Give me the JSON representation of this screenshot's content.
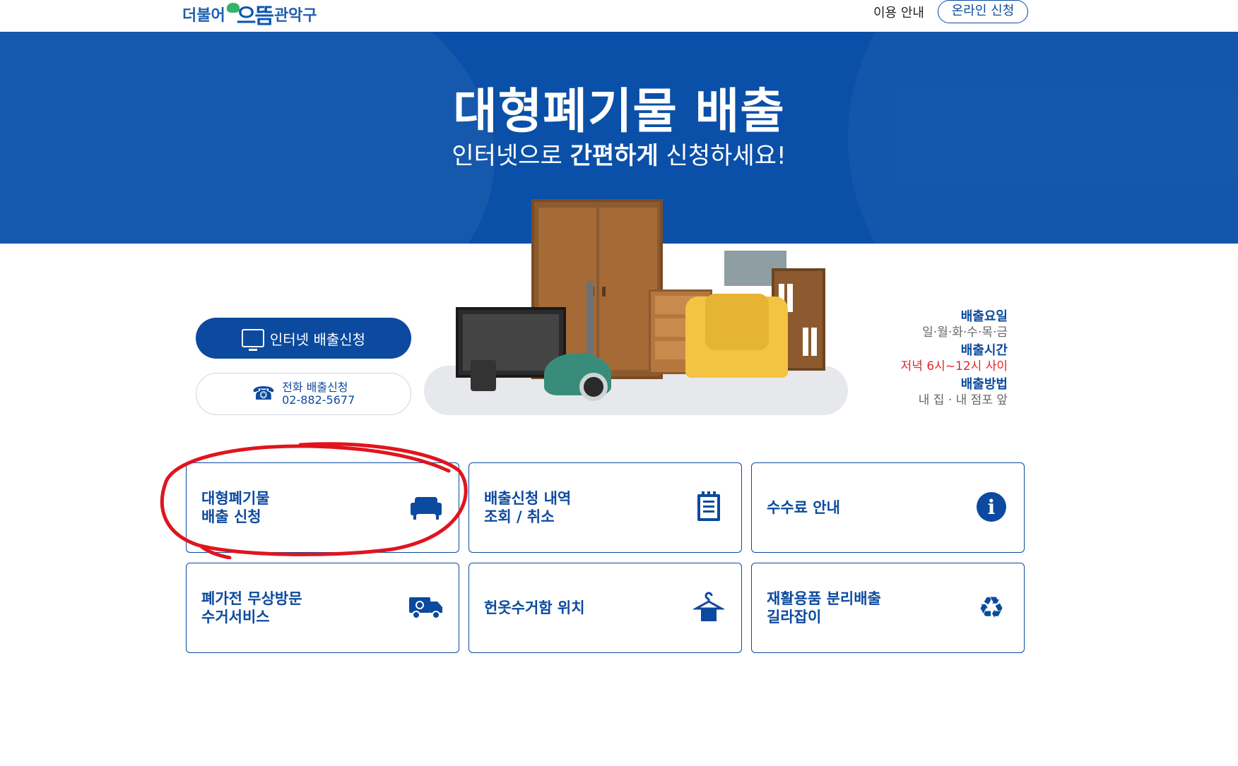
{
  "header": {
    "logo_left": "더불어",
    "logo_mid": "으뜸",
    "logo_right": "관악구",
    "nav_guide": "이용 안내",
    "nav_apply": "온라인 신청"
  },
  "hero": {
    "title": "대형폐기물 배출",
    "subtitle_pre": "인터넷으로 ",
    "subtitle_bold": "간편하게",
    "subtitle_post": " 신청하세요!"
  },
  "buttons": {
    "internet": "인터넷 배출신청",
    "phone_label": "전화 배출신청",
    "phone_number": "02-882-5677"
  },
  "info": {
    "day_label": "배출요일",
    "day_value": "일·월·화·수·목·금",
    "time_label": "배출시간",
    "time_value": "저녁 6시~12시 사이",
    "method_label": "배출방법",
    "method_value": "내 집 · 내 점포 앞"
  },
  "cards": [
    {
      "title": "대형폐기물\n배출 신청",
      "icon": "sofa-icon"
    },
    {
      "title": "배출신청 내역\n조회 / 취소",
      "icon": "notepad-icon"
    },
    {
      "title": "수수료 안내",
      "icon": "info-icon"
    },
    {
      "title": "폐가전 무상방문\n수거서비스",
      "icon": "truck-icon"
    },
    {
      "title": "헌옷수거함 위치",
      "icon": "hanger-icon"
    },
    {
      "title": "재활용품 분리배출\n길라잡이",
      "icon": "recycle-icon"
    }
  ],
  "colors": {
    "primary": "#0b4a9e",
    "hero_bg": "#0a50a8",
    "accent_red": "#e0262a",
    "annotation": "#e0141e"
  }
}
